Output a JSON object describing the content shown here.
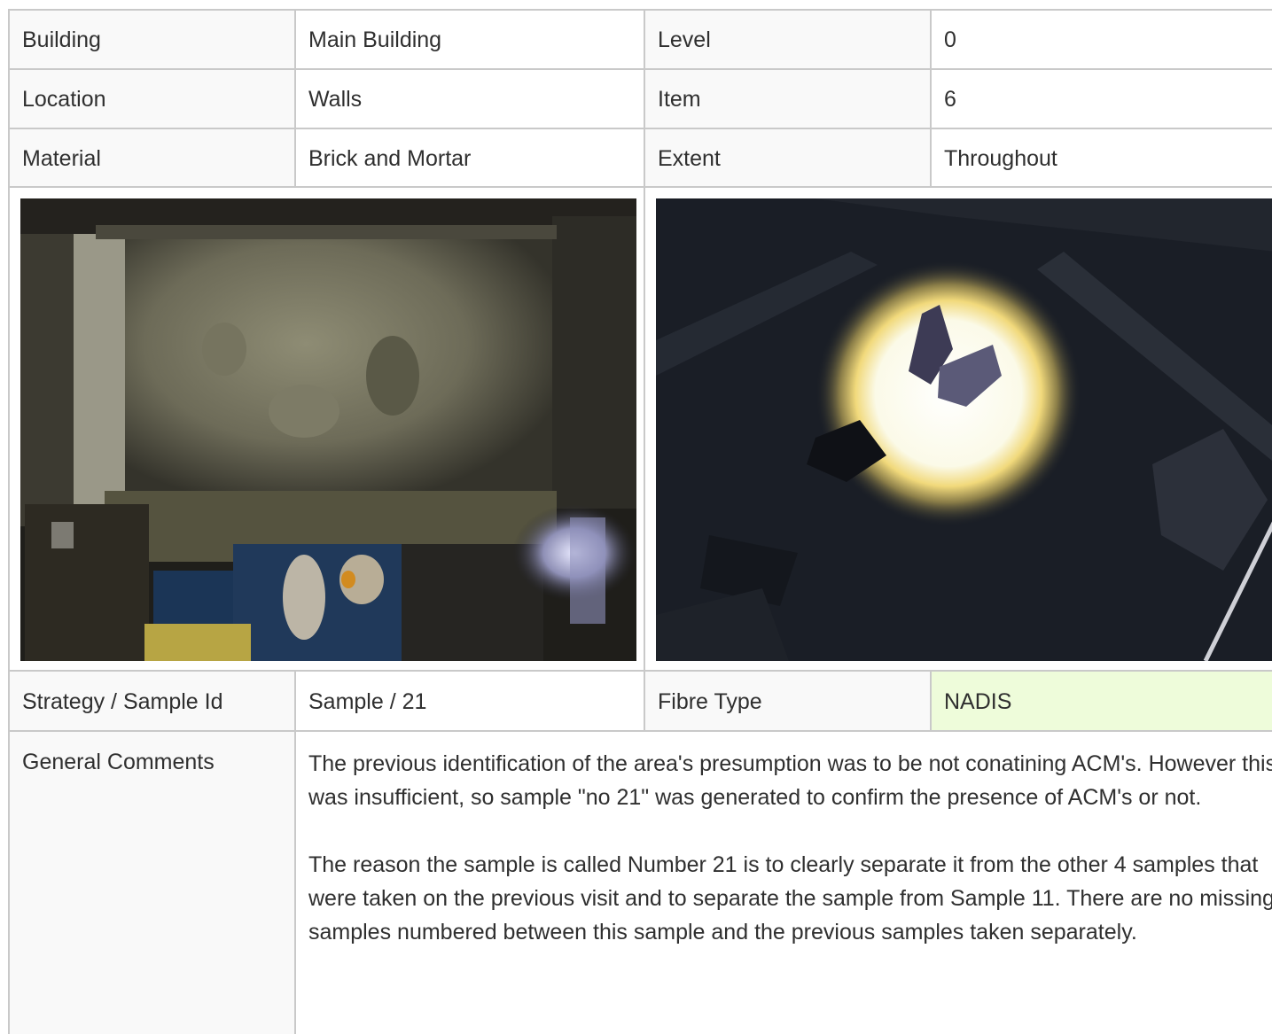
{
  "rows": [
    {
      "label1": "Building",
      "value1": "Main Building",
      "label2": "Level",
      "value2": "0"
    },
    {
      "label1": "Location",
      "value1": "Walls",
      "label2": "Item",
      "value2": "6"
    },
    {
      "label1": "Material",
      "value1": "Brick and Mortar",
      "label2": "Extent",
      "value2": "Throughout"
    }
  ],
  "sample": {
    "label1": "Strategy / Sample Id",
    "value1": "Sample / 21",
    "label2": "Fibre Type",
    "value2": "NADIS",
    "value2_color": "#eefcda"
  },
  "comments": {
    "label": "General Comments",
    "paragraph1": "The previous identification of the area's presumption was to be not conatining ACM's. However this was insufficient, so sample \"no 21\" was generated to confirm the presence of ACM's or not.",
    "paragraph2": "The reason the sample is called Number 21 is to clearly separate it from the other 4 samples that were taken on the previous visit and to separate the sample from Sample 11. There are no missing samples numbered between this sample and the previous samples taken separately."
  },
  "photos": [
    {
      "name": "basement-wall-photo"
    },
    {
      "name": "sample-point-closeup-photo"
    }
  ]
}
